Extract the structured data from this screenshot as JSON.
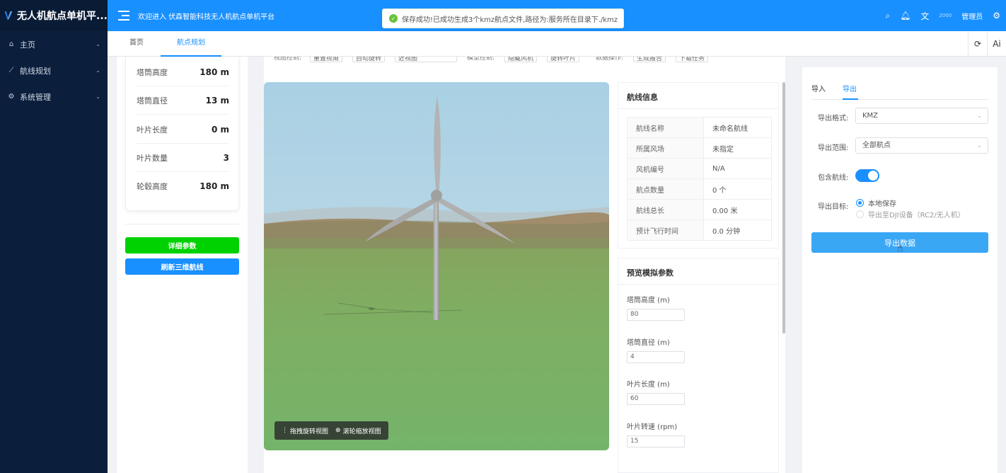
{
  "app": {
    "title": "无人机航点单机平...",
    "accent": "#1990ff"
  },
  "sidebar": {
    "items": [
      {
        "label": "主页",
        "icon": "home-icon"
      },
      {
        "label": "航线规划",
        "icon": "chart-line-icon"
      },
      {
        "label": "系统管理",
        "icon": "gear-icon"
      }
    ]
  },
  "header": {
    "welcome": "欢迎进入 伏森智能科技无人机航点单机平台",
    "admin_avatar": "2000",
    "admin_name": "管理员"
  },
  "toast": {
    "message": "保存成功!已成功生成3个kmz航点文件,路径为:服务所在目录下./kmz",
    "type": "success"
  },
  "tabs": {
    "home": "首页",
    "planning": "航点规划"
  },
  "tools": {
    "ai": "Ai"
  },
  "params": [
    {
      "label": "塔筒高度",
      "value": "180 m"
    },
    {
      "label": "塔筒直径",
      "value": "13 m"
    },
    {
      "label": "叶片长度",
      "value": "0 m"
    },
    {
      "label": "叶片数量",
      "value": "3"
    },
    {
      "label": "轮毂高度",
      "value": "180 m"
    }
  ],
  "buttons": {
    "detail": "详细参数",
    "refresh": "刷新三维航线"
  },
  "controls": {
    "view_label": "视图控制:",
    "view_btn1": "重置视角",
    "view_btn2": "自动旋转",
    "view_select": "近视图",
    "model_label": "模型控制:",
    "model_btn1": "隐藏风机",
    "model_btn2": "旋转叶片",
    "data_label": "数据操作:",
    "data_btn1": "生成报告",
    "data_btn2": "下载任务"
  },
  "view_hints": {
    "drag": "拖拽旋转视图",
    "scroll": "滚轮缩放视图"
  },
  "route_info": {
    "title": "航线信息",
    "rows": [
      {
        "k": "航线名称",
        "v": "未命名航线"
      },
      {
        "k": "所属风场",
        "v": "未指定"
      },
      {
        "k": "风机编号",
        "v": "N/A"
      },
      {
        "k": "航点数量",
        "v": "0 个"
      },
      {
        "k": "航线总长",
        "v": "0.00 米"
      },
      {
        "k": "预计飞行时间",
        "v": "0.0 分钟"
      }
    ]
  },
  "preview": {
    "title": "预览模拟参数",
    "fields": [
      {
        "label": "塔筒高度 (m)",
        "value": "80"
      },
      {
        "label": "塔筒直径 (m)",
        "value": "4"
      },
      {
        "label": "叶片长度 (m)",
        "value": "60"
      },
      {
        "label": "叶片转速 (rpm)",
        "value": "15"
      }
    ]
  },
  "export_panel": {
    "tab_import": "导入",
    "tab_export": "导出",
    "format_label": "导出格式:",
    "format_value": "KMZ",
    "range_label": "导出范围:",
    "range_value": "全部航点",
    "include_label": "包含航线:",
    "include_on": true,
    "target_label": "导出目标:",
    "target_local": "本地保存",
    "target_dji": "导出至DJI设备（RC2/无人机）",
    "export_btn": "导出数据"
  }
}
